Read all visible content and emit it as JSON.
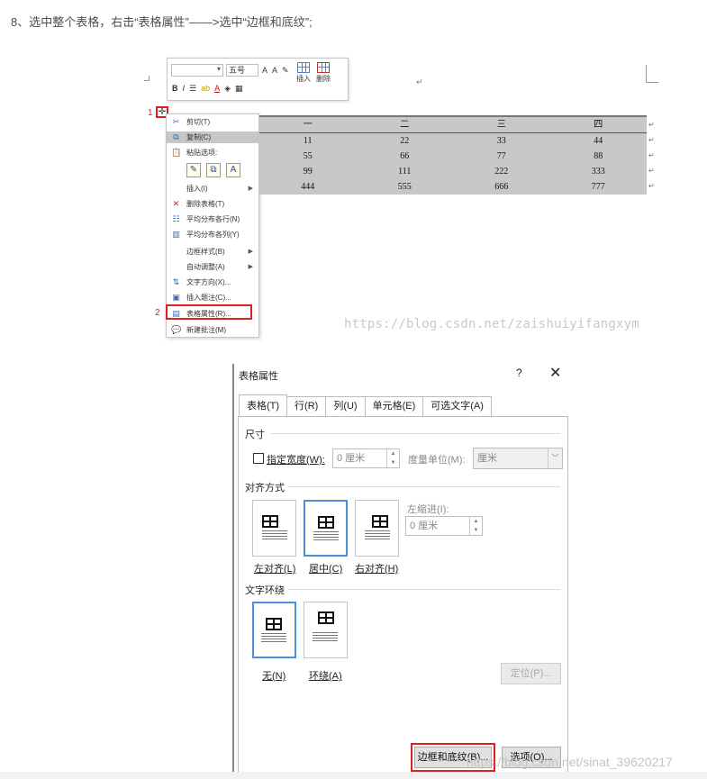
{
  "caption": "8、选中整个表格，右击“表格属性”——>选中“边框和底纹”;",
  "mini_toolbar": {
    "font_size": "五号",
    "grow_font": "A",
    "shrink_font": "A",
    "bold": "B",
    "italic": "I",
    "font_color": "A",
    "insert_label": "插入",
    "delete_label": "删除"
  },
  "step_markers": [
    "1",
    "2"
  ],
  "context_menu": {
    "items": [
      "剪切(T)",
      "复制(C)",
      "粘贴选项:",
      "插入(I)",
      "删除表格(T)",
      "平均分布各行(N)",
      "平均分布各列(Y)",
      "边框样式(B)",
      "自动调整(A)",
      "文字方向(X)...",
      "插入题注(C)...",
      "表格属性(R)...",
      "新建批注(M)"
    ],
    "paste_options": [
      "✎",
      "⧉",
      "A"
    ]
  },
  "word_table": {
    "rows": [
      [
        "一",
        "二",
        "三",
        "四"
      ],
      [
        "11",
        "22",
        "33",
        "44"
      ],
      [
        "55",
        "66",
        "77",
        "88"
      ],
      [
        "99",
        "111",
        "222",
        "333"
      ],
      [
        "444",
        "555",
        "666",
        "777"
      ]
    ]
  },
  "watermark_top": "https://blog.csdn.net/zaishuiyifangxym",
  "dialog": {
    "title": "表格属性",
    "help": "?",
    "close": "✕",
    "tabs": [
      "表格(T)",
      "行(R)",
      "列(U)",
      "单元格(E)",
      "可选文字(A)"
    ],
    "size_section": "尺寸",
    "preferred_width_label": "指定宽度(W):",
    "preferred_width_value": "0 厘米",
    "measure_in_label": "度量单位(M):",
    "measure_in_value": "厘米",
    "alignment_section": "对齐方式",
    "indent_label": "左缩进(I):",
    "indent_value": "0 厘米",
    "alignments": [
      "左对齐(L)",
      "居中(C)",
      "右对齐(H)"
    ],
    "wrapping_section": "文字环绕",
    "wrappings": [
      "无(N)",
      "环绕(A)"
    ],
    "positioning_button": "定位(P)...",
    "borders_button": "边框和底纹(B)...",
    "options_button": "选项(O)..."
  },
  "watermark_bottom": "https://blog.csdn.net/sinat_39620217"
}
